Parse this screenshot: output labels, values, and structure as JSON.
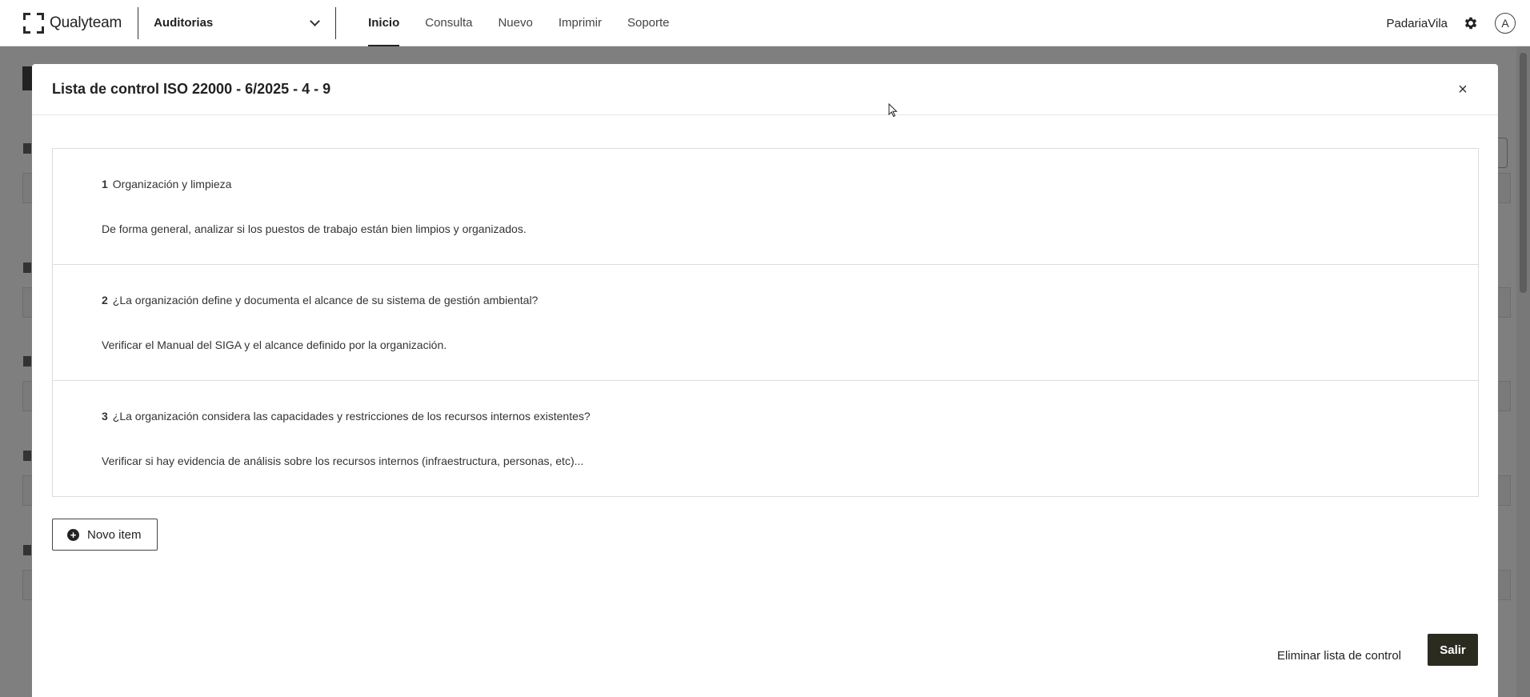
{
  "app": {
    "brand": "Qualyteam",
    "module": "Auditorias",
    "company": "PadariaVila",
    "avatar_initial": "A"
  },
  "nav": {
    "items": [
      {
        "label": "Inicio",
        "active": true
      },
      {
        "label": "Consulta",
        "active": false
      },
      {
        "label": "Nuevo",
        "active": false
      },
      {
        "label": "Imprimir",
        "active": false
      },
      {
        "label": "Soporte",
        "active": false
      }
    ]
  },
  "modal": {
    "title": "Lista de control ISO 22000 - 6/2025 - 4 - 9",
    "close_label": "×",
    "items": [
      {
        "number": "1",
        "title": "Organización y limpieza",
        "description": "De forma general, analizar si los puestos de trabajo están bien limpios y organizados."
      },
      {
        "number": "2",
        "title": "¿La organización define y documenta el alcance de su sistema de gestión ambiental?",
        "description": "Verificar el Manual del SIGA y el alcance definido por la organización."
      },
      {
        "number": "3",
        "title": "¿La organización considera las capacidades y restricciones de los recursos internos existentes?",
        "description": "Verificar si hay evidencia de análisis sobre los recursos internos (infraestructura, personas, etc)..."
      }
    ],
    "new_item_label": "Novo item",
    "delete_label": "Eliminar lista de control",
    "exit_label": "Salir"
  },
  "colors": {
    "accent_dark": "#2b2b1f",
    "overlay": "rgba(0,0,0,0.5)"
  }
}
